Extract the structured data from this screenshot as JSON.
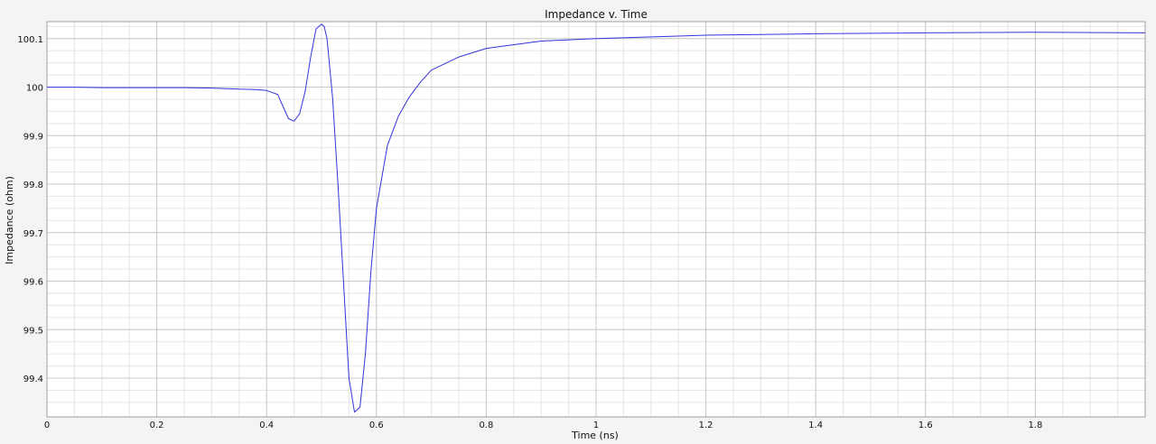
{
  "chart_data": {
    "type": "line",
    "title": "Impedance v. Time",
    "xlabel": "Time (ns)",
    "ylabel": "Impedance (ohm)",
    "xlim": [
      0,
      2
    ],
    "ylim": [
      99.32,
      100.135
    ],
    "x_ticks": [
      0,
      0.2,
      0.4,
      0.6,
      0.8,
      1,
      1.2,
      1.4,
      1.6,
      1.8
    ],
    "x_tick_labels": [
      "0",
      "0.2",
      "0.4",
      "0.6",
      "0.8",
      "1",
      "1.2",
      "1.4",
      "1.6",
      "1.8"
    ],
    "y_ticks": [
      99.4,
      99.5,
      99.6,
      99.7,
      99.8,
      99.9,
      100,
      100.1
    ],
    "y_tick_labels": [
      "99.4",
      "99.5",
      "99.6",
      "99.7",
      "99.8",
      "99.9",
      "100",
      "100.1"
    ],
    "grid": true,
    "minor_grid": true,
    "legend": "none",
    "colors": {
      "line": "#3333dd",
      "grid_major": "#c9c9c9",
      "grid_minor": "#e6e6e6",
      "background": "#ffffff"
    },
    "series": [
      {
        "x": [
          0,
          0.05,
          0.1,
          0.15,
          0.2,
          0.25,
          0.3,
          0.35,
          0.38,
          0.4,
          0.42,
          0.43,
          0.44,
          0.45,
          0.46,
          0.47,
          0.48,
          0.49,
          0.5,
          0.505,
          0.51,
          0.52,
          0.53,
          0.54,
          0.55,
          0.56,
          0.57,
          0.58,
          0.59,
          0.6,
          0.62,
          0.64,
          0.66,
          0.68,
          0.7,
          0.75,
          0.8,
          0.9,
          1.0,
          1.2,
          1.4,
          1.6,
          1.8,
          2.0
        ],
        "y": [
          100.0,
          100.0,
          99.999,
          99.999,
          99.999,
          99.999,
          99.998,
          99.996,
          99.995,
          99.993,
          99.985,
          99.96,
          99.935,
          99.93,
          99.945,
          99.99,
          100.06,
          100.12,
          100.13,
          100.125,
          100.1,
          99.98,
          99.8,
          99.6,
          99.4,
          99.33,
          99.34,
          99.45,
          99.62,
          99.75,
          99.88,
          99.94,
          99.98,
          100.01,
          100.035,
          100.062,
          100.08,
          100.095,
          100.1,
          100.107,
          100.11,
          100.112,
          100.113,
          100.112
        ]
      }
    ]
  }
}
